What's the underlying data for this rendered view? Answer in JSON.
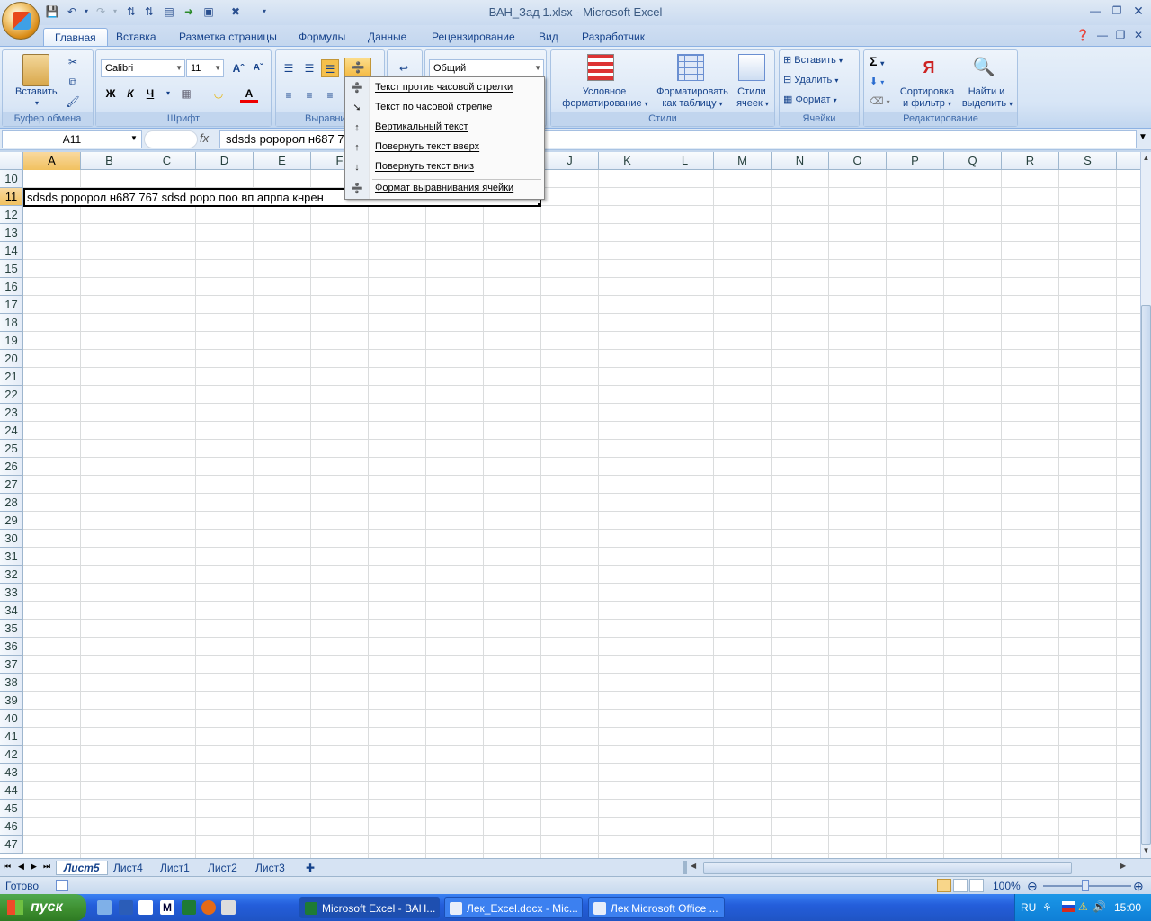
{
  "window": {
    "title": "ВАН_Зад 1.xlsx - Microsoft Excel"
  },
  "tabs": [
    "Главная",
    "Вставка",
    "Разметка страницы",
    "Формулы",
    "Данные",
    "Рецензирование",
    "Вид",
    "Разработчик"
  ],
  "ribbon": {
    "clipboard": {
      "paste": "Вставить",
      "label": "Буфер обмена"
    },
    "font": {
      "name": "Calibri",
      "size": "11",
      "bold": "Ж",
      "italic": "К",
      "underline": "Ч",
      "label": "Шрифт"
    },
    "alignment": {
      "label": "Выравни"
    },
    "number": {
      "format": "Общий"
    },
    "styles": {
      "cond1": "Условное",
      "cond2": "форматирование",
      "table1": "Форматировать",
      "table2": "как таблицу",
      "cell1": "Стили",
      "cell2": "ячеек",
      "label": "Стили"
    },
    "cells": {
      "insert": "Вставить",
      "delete": "Удалить",
      "format": "Формат",
      "label": "Ячейки"
    },
    "editing": {
      "sort1": "Сортировка",
      "sort2": "и фильтр",
      "find1": "Найти и",
      "find2": "выделить",
      "label": "Редактирование",
      "sigma": "Σ"
    }
  },
  "formula_bar": {
    "name_box": "A11",
    "fx": "fx",
    "formula": "sdsds роророл н687 7"
  },
  "columns": [
    "A",
    "B",
    "C",
    "D",
    "E",
    "F",
    "G",
    "H",
    "I",
    "J",
    "K",
    "L",
    "M",
    "N",
    "O",
    "P",
    "Q",
    "R",
    "S"
  ],
  "rows": [
    "10",
    "11",
    "12",
    "13",
    "14",
    "15",
    "16",
    "17",
    "18",
    "19",
    "20",
    "21",
    "22",
    "23",
    "24",
    "25",
    "26",
    "27",
    "28",
    "29",
    "30",
    "31",
    "32",
    "33",
    "34",
    "35",
    "36",
    "37",
    "38",
    "39",
    "40",
    "41",
    "42",
    "43",
    "44",
    "45",
    "46",
    "47"
  ],
  "cell_a11": "sdsds роророл н687 767  sdsd роро поо вп апрпа кнрен",
  "menu": {
    "items": [
      "Текст против часовой стрелки",
      "Текст по часовой стрелке",
      "Вертикальный текст",
      "Повернуть текст вверх",
      "Повернуть текст вниз"
    ],
    "footer": "Формат выравнивания ячейки"
  },
  "sheet_tabs": [
    "Лист5",
    "Лист4",
    "Лист1",
    "Лист2",
    "Лист3"
  ],
  "status": {
    "ready": "Готово",
    "zoom": "100%"
  },
  "taskbar": {
    "start": "пуск",
    "items": [
      "Microsoft Excel - ВАН...",
      "Лек_Excel.docx - Mic...",
      "Лек Microsoft Office ..."
    ],
    "lang": "RU",
    "clock": "15:00"
  }
}
